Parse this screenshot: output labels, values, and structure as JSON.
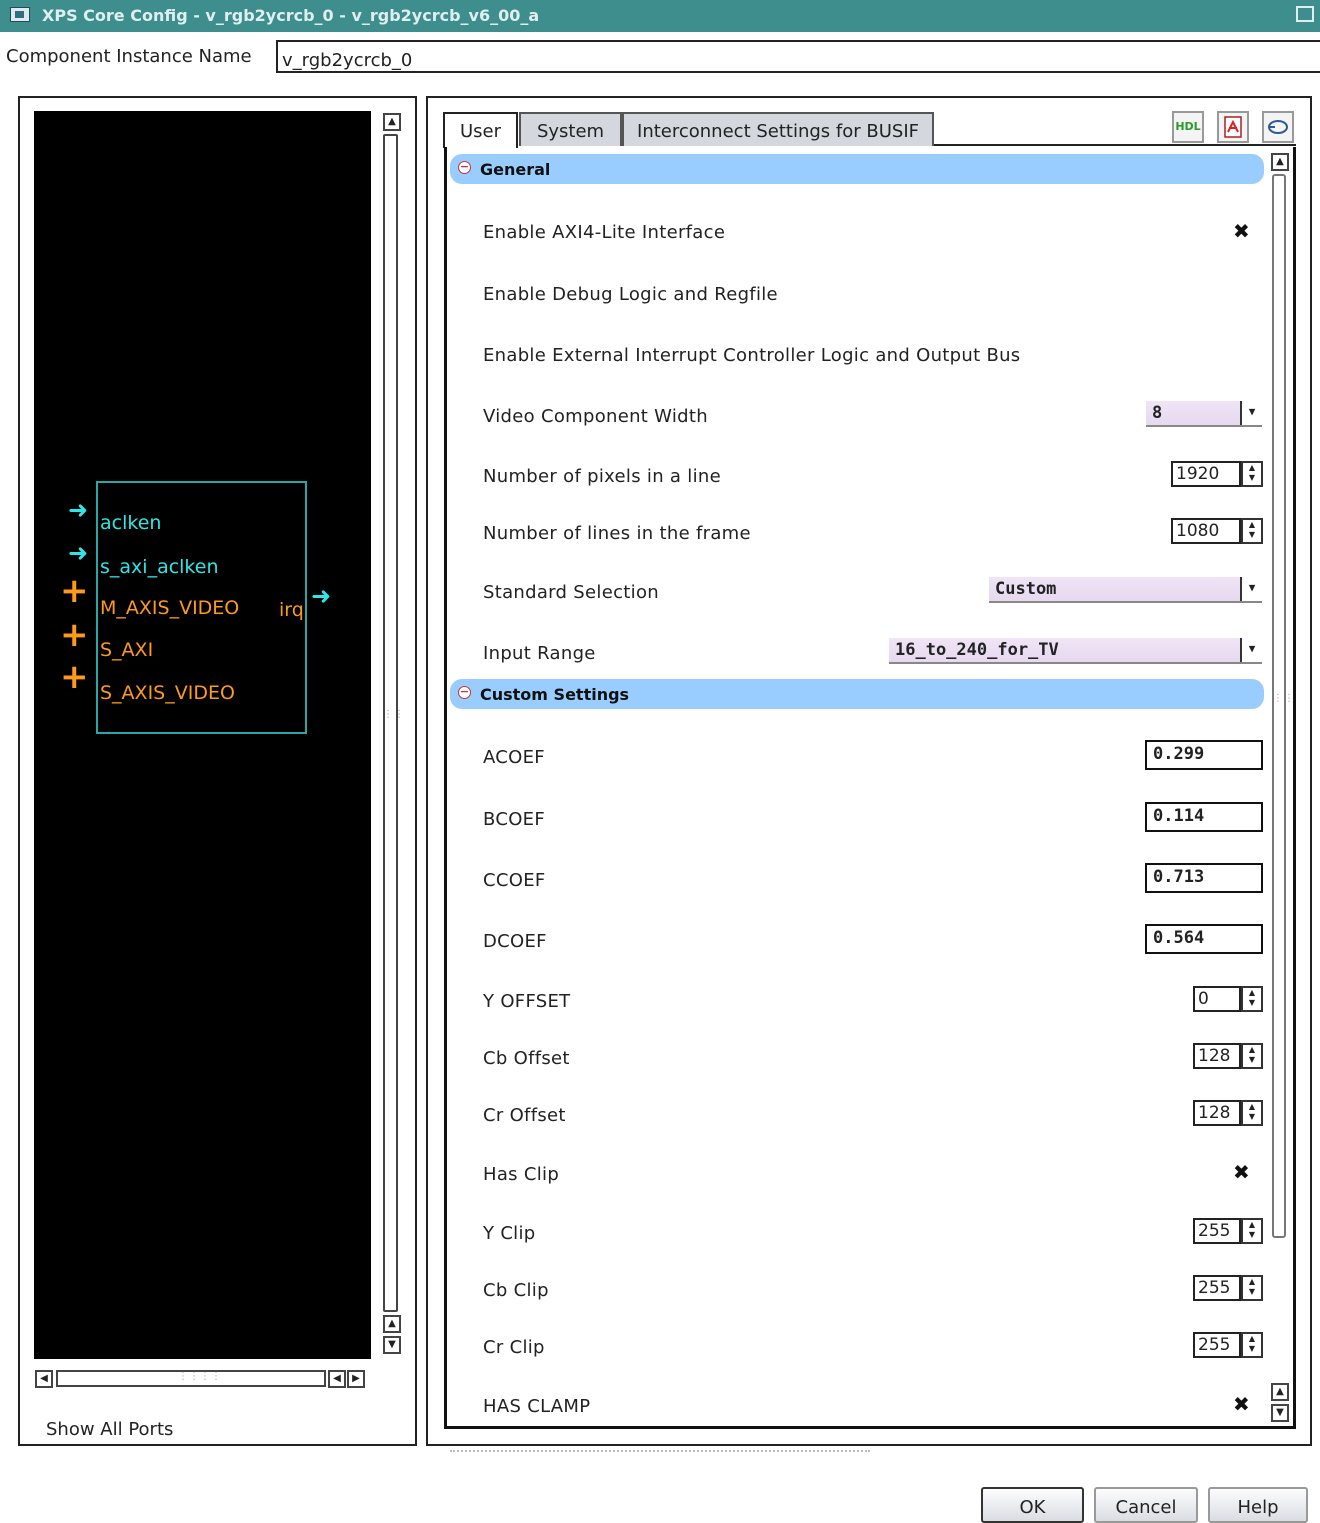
{
  "window": {
    "title": "XPS Core Config - v_rgb2ycrcb_0 - v_rgb2ycrcb_v6_00_a"
  },
  "instance": {
    "label": "Component Instance Name",
    "value": "v_rgb2ycrcb_0"
  },
  "block": {
    "inputs": [
      "aclken",
      "s_axi_aclken",
      "M_AXIS_VIDEO",
      "S_AXI",
      "S_AXIS_VIDEO"
    ],
    "output": "irq"
  },
  "left_panel": {
    "show_all_ports": "Show All Ports"
  },
  "tabs": [
    {
      "label": "User",
      "active": true
    },
    {
      "label": "System",
      "active": false
    },
    {
      "label": "Interconnect Settings for BUSIF",
      "active": false
    }
  ],
  "toolbar": {
    "hdl_label": "HDL",
    "pdf_icon": "pdf-icon",
    "sync_icon": "sync-icon"
  },
  "general": {
    "title": "General",
    "enable_axi4_lite": {
      "label": "Enable AXI4-Lite Interface",
      "checked": true
    },
    "enable_debug": {
      "label": "Enable Debug Logic and Regfile",
      "checked": false
    },
    "enable_interrupt": {
      "label": "Enable External Interrupt Controller Logic and Output Bus",
      "checked": false
    },
    "video_width": {
      "label": "Video Component Width",
      "value": "8"
    },
    "pixels_per_line": {
      "label": "Number of pixels in a line",
      "value": "1920"
    },
    "lines_per_frame": {
      "label": "Number of lines in the frame",
      "value": "1080"
    },
    "standard": {
      "label": "Standard Selection",
      "value": "Custom"
    },
    "input_range": {
      "label": "Input Range",
      "value": "16_to_240_for_TV"
    }
  },
  "custom": {
    "title": "Custom Settings",
    "acoef": {
      "label": "ACOEF",
      "value": "0.299"
    },
    "bcoef": {
      "label": "BCOEF",
      "value": "0.114"
    },
    "ccoef": {
      "label": "CCOEF",
      "value": "0.713"
    },
    "dcoef": {
      "label": "DCOEF",
      "value": "0.564"
    },
    "y_offset": {
      "label": "Y OFFSET",
      "value": "0"
    },
    "cb_offset": {
      "label": "Cb Offset",
      "value": "128"
    },
    "cr_offset": {
      "label": "Cr Offset",
      "value": "128"
    },
    "has_clip": {
      "label": "Has Clip",
      "checked": true
    },
    "y_clip": {
      "label": "Y Clip",
      "value": "255"
    },
    "cb_clip": {
      "label": "Cb Clip",
      "value": "255"
    },
    "cr_clip": {
      "label": "Cr Clip",
      "value": "255"
    },
    "has_clamp": {
      "label": "HAS CLAMP",
      "checked": true
    }
  },
  "buttons": {
    "ok": "OK",
    "cancel": "Cancel",
    "help": "Help"
  },
  "marks": {
    "check": "✖"
  },
  "colors": {
    "titlebar": "#3e8e8e",
    "section_header": "#99ccff",
    "port_cyan": "#2ee6e6",
    "port_orange": "#ff9a1a"
  }
}
